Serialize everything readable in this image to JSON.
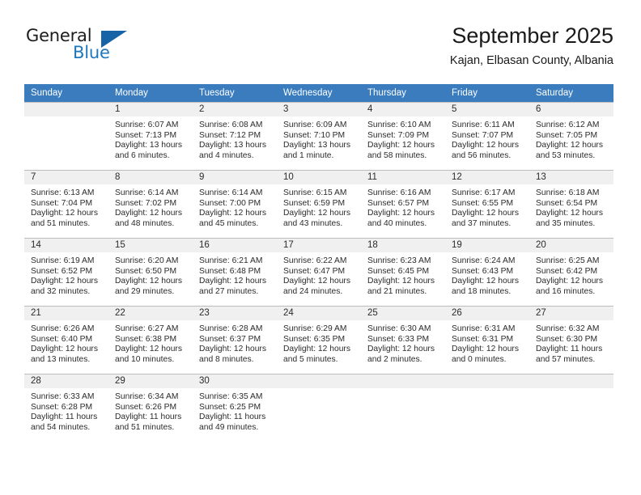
{
  "brand": {
    "name_part1": "General",
    "name_part2": "Blue",
    "colors": {
      "blue": "#1f77be",
      "triangle": "#1763a6",
      "header_bar": "#3a7cbe",
      "daynum_bg": "#f0f0f0"
    }
  },
  "header": {
    "title": "September 2025",
    "subtitle": "Kajan, Elbasan County, Albania"
  },
  "weekday_headers": [
    "Sunday",
    "Monday",
    "Tuesday",
    "Wednesday",
    "Thursday",
    "Friday",
    "Saturday"
  ],
  "weeks": [
    [
      {
        "day": "",
        "sunrise": "",
        "sunset": "",
        "daylight1": "",
        "daylight2": ""
      },
      {
        "day": "1",
        "sunrise": "Sunrise: 6:07 AM",
        "sunset": "Sunset: 7:13 PM",
        "daylight1": "Daylight: 13 hours",
        "daylight2": "and 6 minutes."
      },
      {
        "day": "2",
        "sunrise": "Sunrise: 6:08 AM",
        "sunset": "Sunset: 7:12 PM",
        "daylight1": "Daylight: 13 hours",
        "daylight2": "and 4 minutes."
      },
      {
        "day": "3",
        "sunrise": "Sunrise: 6:09 AM",
        "sunset": "Sunset: 7:10 PM",
        "daylight1": "Daylight: 13 hours",
        "daylight2": "and 1 minute."
      },
      {
        "day": "4",
        "sunrise": "Sunrise: 6:10 AM",
        "sunset": "Sunset: 7:09 PM",
        "daylight1": "Daylight: 12 hours",
        "daylight2": "and 58 minutes."
      },
      {
        "day": "5",
        "sunrise": "Sunrise: 6:11 AM",
        "sunset": "Sunset: 7:07 PM",
        "daylight1": "Daylight: 12 hours",
        "daylight2": "and 56 minutes."
      },
      {
        "day": "6",
        "sunrise": "Sunrise: 6:12 AM",
        "sunset": "Sunset: 7:05 PM",
        "daylight1": "Daylight: 12 hours",
        "daylight2": "and 53 minutes."
      }
    ],
    [
      {
        "day": "7",
        "sunrise": "Sunrise: 6:13 AM",
        "sunset": "Sunset: 7:04 PM",
        "daylight1": "Daylight: 12 hours",
        "daylight2": "and 51 minutes."
      },
      {
        "day": "8",
        "sunrise": "Sunrise: 6:14 AM",
        "sunset": "Sunset: 7:02 PM",
        "daylight1": "Daylight: 12 hours",
        "daylight2": "and 48 minutes."
      },
      {
        "day": "9",
        "sunrise": "Sunrise: 6:14 AM",
        "sunset": "Sunset: 7:00 PM",
        "daylight1": "Daylight: 12 hours",
        "daylight2": "and 45 minutes."
      },
      {
        "day": "10",
        "sunrise": "Sunrise: 6:15 AM",
        "sunset": "Sunset: 6:59 PM",
        "daylight1": "Daylight: 12 hours",
        "daylight2": "and 43 minutes."
      },
      {
        "day": "11",
        "sunrise": "Sunrise: 6:16 AM",
        "sunset": "Sunset: 6:57 PM",
        "daylight1": "Daylight: 12 hours",
        "daylight2": "and 40 minutes."
      },
      {
        "day": "12",
        "sunrise": "Sunrise: 6:17 AM",
        "sunset": "Sunset: 6:55 PM",
        "daylight1": "Daylight: 12 hours",
        "daylight2": "and 37 minutes."
      },
      {
        "day": "13",
        "sunrise": "Sunrise: 6:18 AM",
        "sunset": "Sunset: 6:54 PM",
        "daylight1": "Daylight: 12 hours",
        "daylight2": "and 35 minutes."
      }
    ],
    [
      {
        "day": "14",
        "sunrise": "Sunrise: 6:19 AM",
        "sunset": "Sunset: 6:52 PM",
        "daylight1": "Daylight: 12 hours",
        "daylight2": "and 32 minutes."
      },
      {
        "day": "15",
        "sunrise": "Sunrise: 6:20 AM",
        "sunset": "Sunset: 6:50 PM",
        "daylight1": "Daylight: 12 hours",
        "daylight2": "and 29 minutes."
      },
      {
        "day": "16",
        "sunrise": "Sunrise: 6:21 AM",
        "sunset": "Sunset: 6:48 PM",
        "daylight1": "Daylight: 12 hours",
        "daylight2": "and 27 minutes."
      },
      {
        "day": "17",
        "sunrise": "Sunrise: 6:22 AM",
        "sunset": "Sunset: 6:47 PM",
        "daylight1": "Daylight: 12 hours",
        "daylight2": "and 24 minutes."
      },
      {
        "day": "18",
        "sunrise": "Sunrise: 6:23 AM",
        "sunset": "Sunset: 6:45 PM",
        "daylight1": "Daylight: 12 hours",
        "daylight2": "and 21 minutes."
      },
      {
        "day": "19",
        "sunrise": "Sunrise: 6:24 AM",
        "sunset": "Sunset: 6:43 PM",
        "daylight1": "Daylight: 12 hours",
        "daylight2": "and 18 minutes."
      },
      {
        "day": "20",
        "sunrise": "Sunrise: 6:25 AM",
        "sunset": "Sunset: 6:42 PM",
        "daylight1": "Daylight: 12 hours",
        "daylight2": "and 16 minutes."
      }
    ],
    [
      {
        "day": "21",
        "sunrise": "Sunrise: 6:26 AM",
        "sunset": "Sunset: 6:40 PM",
        "daylight1": "Daylight: 12 hours",
        "daylight2": "and 13 minutes."
      },
      {
        "day": "22",
        "sunrise": "Sunrise: 6:27 AM",
        "sunset": "Sunset: 6:38 PM",
        "daylight1": "Daylight: 12 hours",
        "daylight2": "and 10 minutes."
      },
      {
        "day": "23",
        "sunrise": "Sunrise: 6:28 AM",
        "sunset": "Sunset: 6:37 PM",
        "daylight1": "Daylight: 12 hours",
        "daylight2": "and 8 minutes."
      },
      {
        "day": "24",
        "sunrise": "Sunrise: 6:29 AM",
        "sunset": "Sunset: 6:35 PM",
        "daylight1": "Daylight: 12 hours",
        "daylight2": "and 5 minutes."
      },
      {
        "day": "25",
        "sunrise": "Sunrise: 6:30 AM",
        "sunset": "Sunset: 6:33 PM",
        "daylight1": "Daylight: 12 hours",
        "daylight2": "and 2 minutes."
      },
      {
        "day": "26",
        "sunrise": "Sunrise: 6:31 AM",
        "sunset": "Sunset: 6:31 PM",
        "daylight1": "Daylight: 12 hours",
        "daylight2": "and 0 minutes."
      },
      {
        "day": "27",
        "sunrise": "Sunrise: 6:32 AM",
        "sunset": "Sunset: 6:30 PM",
        "daylight1": "Daylight: 11 hours",
        "daylight2": "and 57 minutes."
      }
    ],
    [
      {
        "day": "28",
        "sunrise": "Sunrise: 6:33 AM",
        "sunset": "Sunset: 6:28 PM",
        "daylight1": "Daylight: 11 hours",
        "daylight2": "and 54 minutes."
      },
      {
        "day": "29",
        "sunrise": "Sunrise: 6:34 AM",
        "sunset": "Sunset: 6:26 PM",
        "daylight1": "Daylight: 11 hours",
        "daylight2": "and 51 minutes."
      },
      {
        "day": "30",
        "sunrise": "Sunrise: 6:35 AM",
        "sunset": "Sunset: 6:25 PM",
        "daylight1": "Daylight: 11 hours",
        "daylight2": "and 49 minutes."
      },
      {
        "day": "",
        "sunrise": "",
        "sunset": "",
        "daylight1": "",
        "daylight2": ""
      },
      {
        "day": "",
        "sunrise": "",
        "sunset": "",
        "daylight1": "",
        "daylight2": ""
      },
      {
        "day": "",
        "sunrise": "",
        "sunset": "",
        "daylight1": "",
        "daylight2": ""
      },
      {
        "day": "",
        "sunrise": "",
        "sunset": "",
        "daylight1": "",
        "daylight2": ""
      }
    ]
  ]
}
